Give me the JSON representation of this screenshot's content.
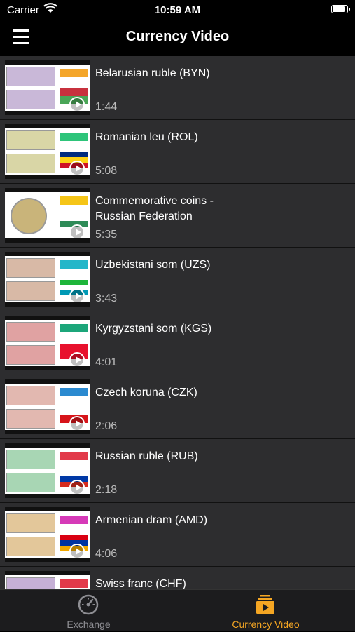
{
  "status": {
    "carrier": "Carrier",
    "time": "10:59 AM",
    "battery_level": 0.95
  },
  "nav": {
    "title": "Currency Video"
  },
  "videos": [
    {
      "title": "Belarusian ruble (BYN)",
      "duration": "1:44",
      "thumb": "notes",
      "note_color": "#c9b8d8",
      "banner_color": "#f4a62a",
      "flag": [
        "#c8313e",
        "#4aa657"
      ]
    },
    {
      "title": "Romanian leu (ROL)",
      "duration": "5:08",
      "thumb": "notes",
      "note_color": "#d9d6a6",
      "banner_color": "#2ec47a",
      "flag": [
        "#002b7f",
        "#fcd116",
        "#ce1126"
      ]
    },
    {
      "title": "Commemorative coins - Russian Federation",
      "duration": "5:35",
      "thumb": "coin",
      "note_color": "#c9b47a",
      "banner_color": "#f5c518",
      "flag": [
        "#ffffff",
        "#2e8b57",
        "#ffffff"
      ]
    },
    {
      "title": "Uzbekistani som (UZS)",
      "duration": "3:43",
      "thumb": "notes",
      "note_color": "#d8b9a6",
      "banner_color": "#23b6c9",
      "flag": [
        "#1eb53a",
        "#ffffff",
        "#0099b5"
      ]
    },
    {
      "title": "Kyrgyzstani som (KGS)",
      "duration": "4:01",
      "thumb": "notes",
      "note_color": "#e0a2a2",
      "banner_color": "#1ca67a",
      "flag": [
        "#e8112d"
      ]
    },
    {
      "title": "Czech koruna (CZK)",
      "duration": "2:06",
      "thumb": "notes",
      "note_color": "#e2b8b0",
      "banner_color": "#2b8ad0",
      "flag": [
        "#ffffff",
        "#d7141a"
      ]
    },
    {
      "title": "Russian ruble (RUB)",
      "duration": "2:18",
      "thumb": "notes",
      "note_color": "#a8d6b4",
      "banner_color": "#e23a4a",
      "flag": [
        "#ffffff",
        "#0039a6",
        "#d52b1e"
      ]
    },
    {
      "title": "Armenian dram (AMD)",
      "duration": "4:06",
      "thumb": "notes",
      "note_color": "#e3c79a",
      "banner_color": "#d63ab8",
      "flag": [
        "#d90012",
        "#0033a0",
        "#f2a800"
      ]
    },
    {
      "title": "Swiss franc (CHF)",
      "duration": "",
      "thumb": "notes",
      "note_color": "#c6b0d6",
      "banner_color": "#e23a4a",
      "flag": [
        "#d52b1e"
      ]
    }
  ],
  "tabs": [
    {
      "label": "Exchange",
      "icon": "gauge-icon",
      "color": "#8e8e93",
      "active": false
    },
    {
      "label": "Currency Video",
      "icon": "video-library-icon",
      "color": "#f5a623",
      "active": true
    }
  ]
}
